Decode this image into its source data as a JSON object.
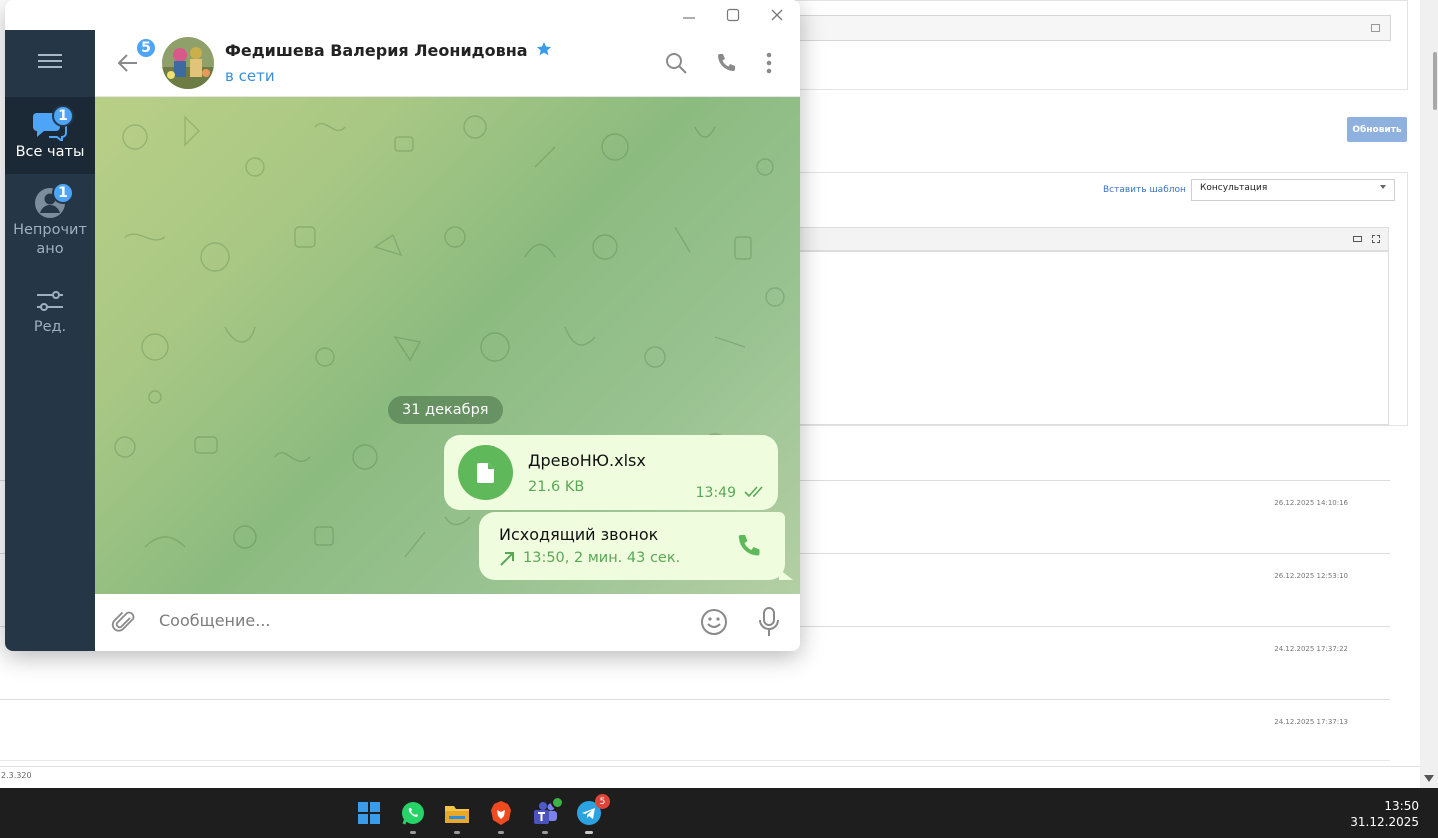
{
  "background_page": {
    "update_button": "Обновить",
    "insert_template_link": "Вставить шаблон",
    "template_select_value": "Консультация",
    "rows": [
      {
        "timestamp": "26.12.2025 14:10:16"
      },
      {
        "timestamp": "26.12.2025 12:53:10"
      },
      {
        "timestamp": "24.12.2025 17:37:22"
      },
      {
        "timestamp": "24.12.2025 17:37:13"
      }
    ],
    "version": "2.3.320"
  },
  "telegram": {
    "sidebar": {
      "items": [
        {
          "label": "Все чаты",
          "badge": "1",
          "icon": "chats-icon"
        },
        {
          "label": "Непрочитано",
          "badge": "1",
          "icon": "unread-icon"
        },
        {
          "label": "Ред.",
          "icon": "filters-edit-icon"
        }
      ]
    },
    "header": {
      "back_badge": "5",
      "chat_name": "Федишева Валерия Леонидовна",
      "status": "в сети"
    },
    "messages": {
      "date": "31 декабря",
      "file": {
        "name": "ДревоНЮ.xlsx",
        "size": "21.6 KB",
        "time": "13:49"
      },
      "call": {
        "title": "Исходящий звонок",
        "meta": "13:50, 2 мин. 43 сек."
      }
    },
    "compose": {
      "placeholder": "Сообщение..."
    }
  },
  "taskbar": {
    "apps": [
      "windows-start",
      "whatsapp",
      "file-explorer",
      "brave",
      "teams",
      "telegram"
    ],
    "telegram_badge": "5",
    "time": "13:50",
    "date": "31.12.2025"
  },
  "colors": {
    "sidebar_bg": "#253647",
    "accent_blue": "#4ea4f6",
    "bubble_out": "#effdde",
    "green_text": "#5aa857"
  }
}
